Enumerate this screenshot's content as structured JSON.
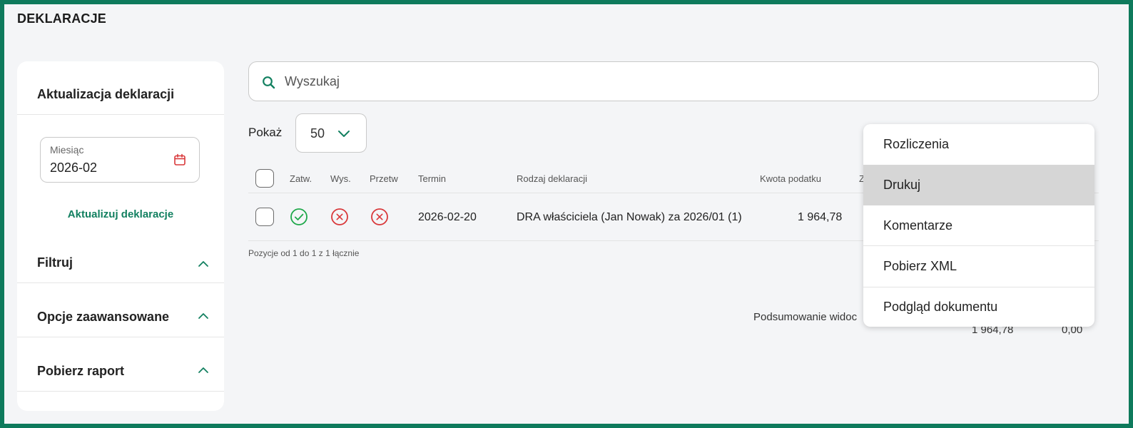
{
  "page": {
    "title": "DEKLARACJE"
  },
  "sidebar": {
    "update_title": "Aktualizacja deklaracji",
    "month": {
      "label": "Miesiąc",
      "value": "2026-02"
    },
    "update_link": "Aktualizuj deklaracje",
    "sections": [
      {
        "label": "Filtruj"
      },
      {
        "label": "Opcje zaawansowane"
      },
      {
        "label": "Pobierz raport"
      }
    ]
  },
  "search": {
    "placeholder": "Wyszukaj"
  },
  "show": {
    "label": "Pokaż",
    "value": "50"
  },
  "table": {
    "headers": {
      "approved": "Zatw.",
      "sent": "Wys.",
      "processed": "Przetw",
      "due": "Termin",
      "type": "Rodzaj deklaracji",
      "amount": "Kwota podatku",
      "next": "Z"
    },
    "rows": [
      {
        "approved": true,
        "sent": false,
        "processed": false,
        "due": "2026-02-20",
        "type": "DRA właściciela (Jan Nowak) za 2026/01 (1)",
        "amount": "1 964,78"
      }
    ],
    "pager": "Pozycje od 1 do 1 z 1 łącznie"
  },
  "summary": {
    "label": "Podsumowanie widoc",
    "values": [
      "1 964,78",
      "0,00"
    ]
  },
  "context_menu": {
    "items": [
      {
        "label": "Rozliczenia"
      },
      {
        "label": "Drukuj"
      },
      {
        "label": "Komentarze"
      },
      {
        "label": "Pobierz XML"
      },
      {
        "label": "Podgląd dokumentu"
      }
    ]
  },
  "colors": {
    "brand": "#0e7a5c",
    "link": "#128060",
    "success": "#1ea84a",
    "error": "#d9383a",
    "hover": "#d6d6d6"
  },
  "icons": {
    "search": "search-icon",
    "calendar": "calendar-icon",
    "chevron_down": "chevron-down-icon",
    "chevron_up": "chevron-up-icon",
    "check_circle": "check-circle-icon",
    "x_circle": "x-circle-icon"
  }
}
